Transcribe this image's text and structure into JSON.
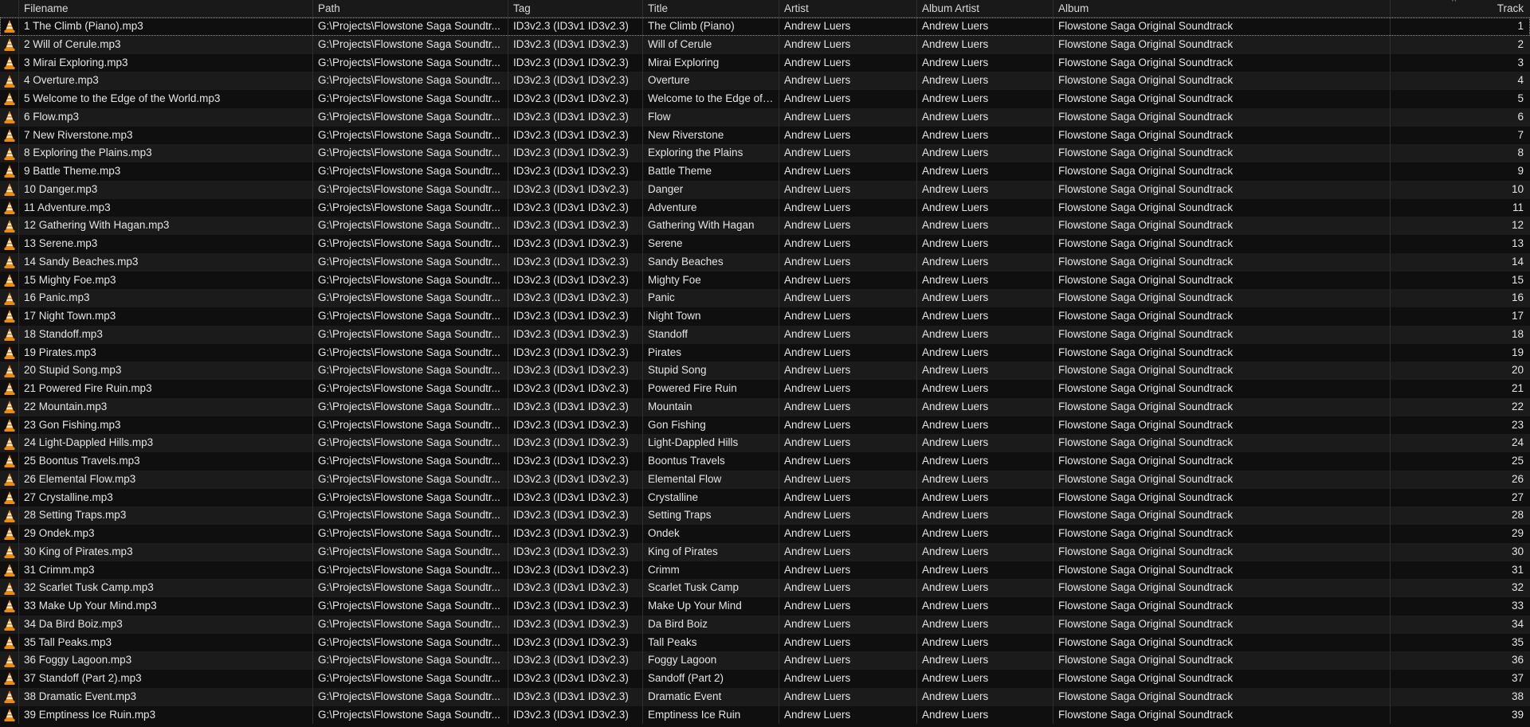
{
  "columns": {
    "filename": "Filename",
    "path": "Path",
    "tag": "Tag",
    "title": "Title",
    "artist": "Artist",
    "album_artist": "Album Artist",
    "album": "Album",
    "track": "Track"
  },
  "sort_indicator": "^",
  "rows": [
    {
      "filename": "1 The Climb (Piano).mp3",
      "path": "G:\\Projects\\Flowstone Saga Soundtr...",
      "tag": "ID3v2.3 (ID3v1 ID3v2.3)",
      "title": "The Climb (Piano)",
      "artist": "Andrew Luers",
      "album_artist": "Andrew Luers",
      "album": "Flowstone Saga Original Soundtrack",
      "track": "1"
    },
    {
      "filename": "2 Will of Cerule.mp3",
      "path": "G:\\Projects\\Flowstone Saga Soundtr...",
      "tag": "ID3v2.3 (ID3v1 ID3v2.3)",
      "title": "Will of Cerule",
      "artist": "Andrew Luers",
      "album_artist": "Andrew Luers",
      "album": "Flowstone Saga Original Soundtrack",
      "track": "2"
    },
    {
      "filename": "3 Mirai Exploring.mp3",
      "path": "G:\\Projects\\Flowstone Saga Soundtr...",
      "tag": "ID3v2.3 (ID3v1 ID3v2.3)",
      "title": "Mirai Exploring",
      "artist": "Andrew Luers",
      "album_artist": "Andrew Luers",
      "album": "Flowstone Saga Original Soundtrack",
      "track": "3"
    },
    {
      "filename": "4 Overture.mp3",
      "path": "G:\\Projects\\Flowstone Saga Soundtr...",
      "tag": "ID3v2.3 (ID3v1 ID3v2.3)",
      "title": "Overture",
      "artist": "Andrew Luers",
      "album_artist": "Andrew Luers",
      "album": "Flowstone Saga Original Soundtrack",
      "track": "4"
    },
    {
      "filename": "5 Welcome to the Edge of the World.mp3",
      "path": "G:\\Projects\\Flowstone Saga Soundtr...",
      "tag": "ID3v2.3 (ID3v1 ID3v2.3)",
      "title": "Welcome to the Edge of ...",
      "artist": "Andrew Luers",
      "album_artist": "Andrew Luers",
      "album": "Flowstone Saga Original Soundtrack",
      "track": "5"
    },
    {
      "filename": "6 Flow.mp3",
      "path": "G:\\Projects\\Flowstone Saga Soundtr...",
      "tag": "ID3v2.3 (ID3v1 ID3v2.3)",
      "title": "Flow",
      "artist": "Andrew Luers",
      "album_artist": "Andrew Luers",
      "album": "Flowstone Saga Original Soundtrack",
      "track": "6"
    },
    {
      "filename": "7 New Riverstone.mp3",
      "path": "G:\\Projects\\Flowstone Saga Soundtr...",
      "tag": "ID3v2.3 (ID3v1 ID3v2.3)",
      "title": "New Riverstone",
      "artist": "Andrew Luers",
      "album_artist": "Andrew Luers",
      "album": "Flowstone Saga Original Soundtrack",
      "track": "7"
    },
    {
      "filename": "8 Exploring the Plains.mp3",
      "path": "G:\\Projects\\Flowstone Saga Soundtr...",
      "tag": "ID3v2.3 (ID3v1 ID3v2.3)",
      "title": "Exploring the Plains",
      "artist": "Andrew Luers",
      "album_artist": "Andrew Luers",
      "album": "Flowstone Saga Original Soundtrack",
      "track": "8"
    },
    {
      "filename": "9 Battle Theme.mp3",
      "path": "G:\\Projects\\Flowstone Saga Soundtr...",
      "tag": "ID3v2.3 (ID3v1 ID3v2.3)",
      "title": "Battle Theme",
      "artist": "Andrew Luers",
      "album_artist": "Andrew Luers",
      "album": "Flowstone Saga Original Soundtrack",
      "track": "9"
    },
    {
      "filename": "10 Danger.mp3",
      "path": "G:\\Projects\\Flowstone Saga Soundtr...",
      "tag": "ID3v2.3 (ID3v1 ID3v2.3)",
      "title": "Danger",
      "artist": "Andrew Luers",
      "album_artist": "Andrew Luers",
      "album": "Flowstone Saga Original Soundtrack",
      "track": "10"
    },
    {
      "filename": "11 Adventure.mp3",
      "path": "G:\\Projects\\Flowstone Saga Soundtr...",
      "tag": "ID3v2.3 (ID3v1 ID3v2.3)",
      "title": "Adventure",
      "artist": "Andrew Luers",
      "album_artist": "Andrew Luers",
      "album": "Flowstone Saga Original Soundtrack",
      "track": "11"
    },
    {
      "filename": "12 Gathering With Hagan.mp3",
      "path": "G:\\Projects\\Flowstone Saga Soundtr...",
      "tag": "ID3v2.3 (ID3v1 ID3v2.3)",
      "title": "Gathering With Hagan",
      "artist": "Andrew Luers",
      "album_artist": "Andrew Luers",
      "album": "Flowstone Saga Original Soundtrack",
      "track": "12"
    },
    {
      "filename": "13 Serene.mp3",
      "path": "G:\\Projects\\Flowstone Saga Soundtr...",
      "tag": "ID3v2.3 (ID3v1 ID3v2.3)",
      "title": "Serene",
      "artist": "Andrew Luers",
      "album_artist": "Andrew Luers",
      "album": "Flowstone Saga Original Soundtrack",
      "track": "13"
    },
    {
      "filename": "14 Sandy Beaches.mp3",
      "path": "G:\\Projects\\Flowstone Saga Soundtr...",
      "tag": "ID3v2.3 (ID3v1 ID3v2.3)",
      "title": "Sandy Beaches",
      "artist": "Andrew Luers",
      "album_artist": "Andrew Luers",
      "album": "Flowstone Saga Original Soundtrack",
      "track": "14"
    },
    {
      "filename": "15 Mighty Foe.mp3",
      "path": "G:\\Projects\\Flowstone Saga Soundtr...",
      "tag": "ID3v2.3 (ID3v1 ID3v2.3)",
      "title": "Mighty Foe",
      "artist": "Andrew Luers",
      "album_artist": "Andrew Luers",
      "album": "Flowstone Saga Original Soundtrack",
      "track": "15"
    },
    {
      "filename": "16 Panic.mp3",
      "path": "G:\\Projects\\Flowstone Saga Soundtr...",
      "tag": "ID3v2.3 (ID3v1 ID3v2.3)",
      "title": "Panic",
      "artist": "Andrew Luers",
      "album_artist": "Andrew Luers",
      "album": "Flowstone Saga Original Soundtrack",
      "track": "16"
    },
    {
      "filename": "17 Night Town.mp3",
      "path": "G:\\Projects\\Flowstone Saga Soundtr...",
      "tag": "ID3v2.3 (ID3v1 ID3v2.3)",
      "title": "Night Town",
      "artist": "Andrew Luers",
      "album_artist": "Andrew Luers",
      "album": "Flowstone Saga Original Soundtrack",
      "track": "17"
    },
    {
      "filename": "18 Standoff.mp3",
      "path": "G:\\Projects\\Flowstone Saga Soundtr...",
      "tag": "ID3v2.3 (ID3v1 ID3v2.3)",
      "title": "Standoff",
      "artist": "Andrew Luers",
      "album_artist": "Andrew Luers",
      "album": "Flowstone Saga Original Soundtrack",
      "track": "18"
    },
    {
      "filename": "19 Pirates.mp3",
      "path": "G:\\Projects\\Flowstone Saga Soundtr...",
      "tag": "ID3v2.3 (ID3v1 ID3v2.3)",
      "title": "Pirates",
      "artist": "Andrew Luers",
      "album_artist": "Andrew Luers",
      "album": "Flowstone Saga Original Soundtrack",
      "track": "19"
    },
    {
      "filename": "20 Stupid Song.mp3",
      "path": "G:\\Projects\\Flowstone Saga Soundtr...",
      "tag": "ID3v2.3 (ID3v1 ID3v2.3)",
      "title": "Stupid Song",
      "artist": "Andrew Luers",
      "album_artist": "Andrew Luers",
      "album": "Flowstone Saga Original Soundtrack",
      "track": "20"
    },
    {
      "filename": "21 Powered Fire Ruin.mp3",
      "path": "G:\\Projects\\Flowstone Saga Soundtr...",
      "tag": "ID3v2.3 (ID3v1 ID3v2.3)",
      "title": "Powered Fire Ruin",
      "artist": "Andrew Luers",
      "album_artist": "Andrew Luers",
      "album": "Flowstone Saga Original Soundtrack",
      "track": "21"
    },
    {
      "filename": "22 Mountain.mp3",
      "path": "G:\\Projects\\Flowstone Saga Soundtr...",
      "tag": "ID3v2.3 (ID3v1 ID3v2.3)",
      "title": "Mountain",
      "artist": "Andrew Luers",
      "album_artist": "Andrew Luers",
      "album": "Flowstone Saga Original Soundtrack",
      "track": "22"
    },
    {
      "filename": "23 Gon Fishing.mp3",
      "path": "G:\\Projects\\Flowstone Saga Soundtr...",
      "tag": "ID3v2.3 (ID3v1 ID3v2.3)",
      "title": "Gon Fishing",
      "artist": "Andrew Luers",
      "album_artist": "Andrew Luers",
      "album": "Flowstone Saga Original Soundtrack",
      "track": "23"
    },
    {
      "filename": "24 Light-Dappled Hills.mp3",
      "path": "G:\\Projects\\Flowstone Saga Soundtr...",
      "tag": "ID3v2.3 (ID3v1 ID3v2.3)",
      "title": "Light-Dappled Hills",
      "artist": "Andrew Luers",
      "album_artist": "Andrew Luers",
      "album": "Flowstone Saga Original Soundtrack",
      "track": "24"
    },
    {
      "filename": "25 Boontus Travels.mp3",
      "path": "G:\\Projects\\Flowstone Saga Soundtr...",
      "tag": "ID3v2.3 (ID3v1 ID3v2.3)",
      "title": "Boontus Travels",
      "artist": "Andrew Luers",
      "album_artist": "Andrew Luers",
      "album": "Flowstone Saga Original Soundtrack",
      "track": "25"
    },
    {
      "filename": "26 Elemental Flow.mp3",
      "path": "G:\\Projects\\Flowstone Saga Soundtr...",
      "tag": "ID3v2.3 (ID3v1 ID3v2.3)",
      "title": "Elemental Flow",
      "artist": "Andrew Luers",
      "album_artist": "Andrew Luers",
      "album": "Flowstone Saga Original Soundtrack",
      "track": "26"
    },
    {
      "filename": "27 Crystalline.mp3",
      "path": "G:\\Projects\\Flowstone Saga Soundtr...",
      "tag": "ID3v2.3 (ID3v1 ID3v2.3)",
      "title": "Crystalline",
      "artist": "Andrew Luers",
      "album_artist": "Andrew Luers",
      "album": "Flowstone Saga Original Soundtrack",
      "track": "27"
    },
    {
      "filename": "28 Setting Traps.mp3",
      "path": "G:\\Projects\\Flowstone Saga Soundtr...",
      "tag": "ID3v2.3 (ID3v1 ID3v2.3)",
      "title": "Setting Traps",
      "artist": "Andrew Luers",
      "album_artist": "Andrew Luers",
      "album": "Flowstone Saga Original Soundtrack",
      "track": "28"
    },
    {
      "filename": "29 Ondek.mp3",
      "path": "G:\\Projects\\Flowstone Saga Soundtr...",
      "tag": "ID3v2.3 (ID3v1 ID3v2.3)",
      "title": "Ondek",
      "artist": "Andrew Luers",
      "album_artist": "Andrew Luers",
      "album": "Flowstone Saga Original Soundtrack",
      "track": "29"
    },
    {
      "filename": "30 King of Pirates.mp3",
      "path": "G:\\Projects\\Flowstone Saga Soundtr...",
      "tag": "ID3v2.3 (ID3v1 ID3v2.3)",
      "title": "King of Pirates",
      "artist": "Andrew Luers",
      "album_artist": "Andrew Luers",
      "album": "Flowstone Saga Original Soundtrack",
      "track": "30"
    },
    {
      "filename": "31 Crimm.mp3",
      "path": "G:\\Projects\\Flowstone Saga Soundtr...",
      "tag": "ID3v2.3 (ID3v1 ID3v2.3)",
      "title": "Crimm",
      "artist": "Andrew Luers",
      "album_artist": "Andrew Luers",
      "album": "Flowstone Saga Original Soundtrack",
      "track": "31"
    },
    {
      "filename": "32 Scarlet Tusk Camp.mp3",
      "path": "G:\\Projects\\Flowstone Saga Soundtr...",
      "tag": "ID3v2.3 (ID3v1 ID3v2.3)",
      "title": "Scarlet Tusk Camp",
      "artist": "Andrew Luers",
      "album_artist": "Andrew Luers",
      "album": "Flowstone Saga Original Soundtrack",
      "track": "32"
    },
    {
      "filename": "33 Make Up Your Mind.mp3",
      "path": "G:\\Projects\\Flowstone Saga Soundtr...",
      "tag": "ID3v2.3 (ID3v1 ID3v2.3)",
      "title": "Make Up Your Mind",
      "artist": "Andrew Luers",
      "album_artist": "Andrew Luers",
      "album": "Flowstone Saga Original Soundtrack",
      "track": "33"
    },
    {
      "filename": "34 Da Bird Boiz.mp3",
      "path": "G:\\Projects\\Flowstone Saga Soundtr...",
      "tag": "ID3v2.3 (ID3v1 ID3v2.3)",
      "title": "Da Bird Boiz",
      "artist": "Andrew Luers",
      "album_artist": "Andrew Luers",
      "album": "Flowstone Saga Original Soundtrack",
      "track": "34"
    },
    {
      "filename": "35 Tall Peaks.mp3",
      "path": "G:\\Projects\\Flowstone Saga Soundtr...",
      "tag": "ID3v2.3 (ID3v1 ID3v2.3)",
      "title": "Tall Peaks",
      "artist": "Andrew Luers",
      "album_artist": "Andrew Luers",
      "album": "Flowstone Saga Original Soundtrack",
      "track": "35"
    },
    {
      "filename": "36 Foggy Lagoon.mp3",
      "path": "G:\\Projects\\Flowstone Saga Soundtr...",
      "tag": "ID3v2.3 (ID3v1 ID3v2.3)",
      "title": "Foggy Lagoon",
      "artist": "Andrew Luers",
      "album_artist": "Andrew Luers",
      "album": "Flowstone Saga Original Soundtrack",
      "track": "36"
    },
    {
      "filename": "37 Standoff (Part 2).mp3",
      "path": "G:\\Projects\\Flowstone Saga Soundtr...",
      "tag": "ID3v2.3 (ID3v1 ID3v2.3)",
      "title": "Sandoff (Part 2)",
      "artist": "Andrew Luers",
      "album_artist": "Andrew Luers",
      "album": "Flowstone Saga Original Soundtrack",
      "track": "37"
    },
    {
      "filename": "38 Dramatic Event.mp3",
      "path": "G:\\Projects\\Flowstone Saga Soundtr...",
      "tag": "ID3v2.3 (ID3v1 ID3v2.3)",
      "title": "Dramatic Event",
      "artist": "Andrew Luers",
      "album_artist": "Andrew Luers",
      "album": "Flowstone Saga Original Soundtrack",
      "track": "38"
    },
    {
      "filename": "39 Emptiness Ice Ruin.mp3",
      "path": "G:\\Projects\\Flowstone Saga Soundtr...",
      "tag": "ID3v2.3 (ID3v1 ID3v2.3)",
      "title": "Emptiness Ice Ruin",
      "artist": "Andrew Luers",
      "album_artist": "Andrew Luers",
      "album": "Flowstone Saga Original Soundtrack",
      "track": "39"
    }
  ],
  "icon": "vlc-cone-icon",
  "colors": {
    "cone_orange": "#f08c00",
    "cone_white": "#e8e8e8",
    "bg_dark": "#0f0f0f",
    "bg_alt": "#1b1b1b"
  }
}
